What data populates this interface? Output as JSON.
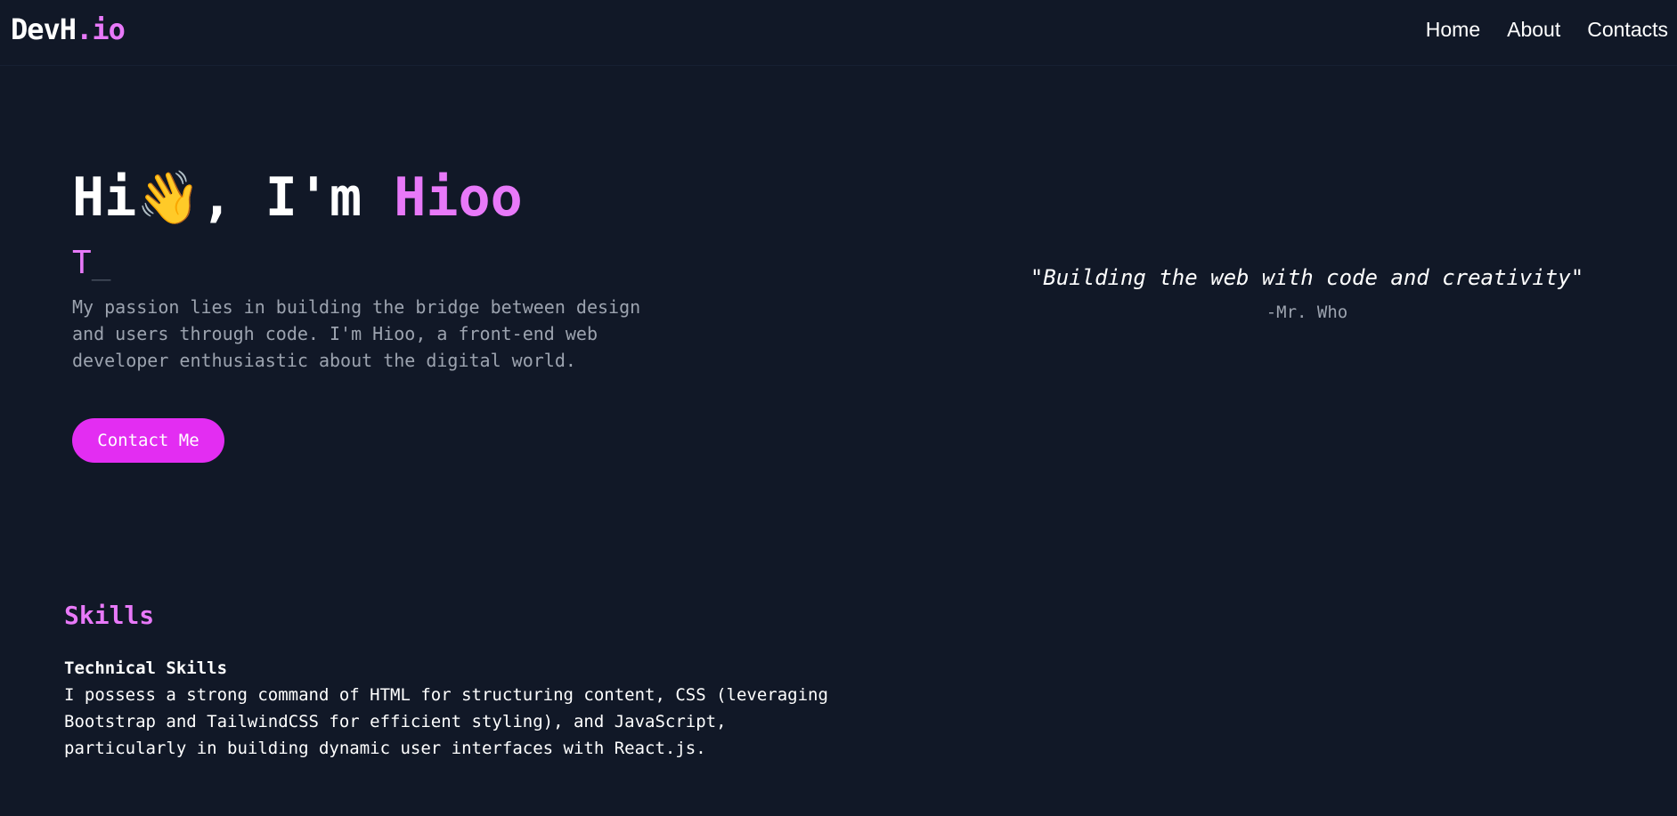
{
  "header": {
    "logo_main": "DevH",
    "logo_dot": ".",
    "logo_tld": "io",
    "nav": [
      "Home",
      "About",
      "Contacts"
    ]
  },
  "hero": {
    "greeting": "Hi",
    "emoji": "👋",
    "comma_text": ", I'm ",
    "name": "Hioo",
    "typing_text": "T",
    "typing_cursor": "_",
    "intro": "My passion lies in building the bridge between design and users through code. I'm Hioo, a front-end web developer enthusiastic about the digital world.",
    "cta_label": "Contact Me"
  },
  "quote": {
    "text": "\"Building the web with code and creativity\"",
    "author": "-Mr. Who"
  },
  "skills": {
    "title": "Skills",
    "subtitle": "Technical Skills",
    "description": "I possess a strong command of HTML for structuring content, CSS (leveraging Bootstrap and TailwindCSS for efficient styling), and JavaScript, particularly in building dynamic user interfaces with React.js."
  },
  "colors": {
    "background": "#111827",
    "accent": "#e879f9",
    "button": "#e32df2",
    "muted_text": "#9ca3af"
  }
}
